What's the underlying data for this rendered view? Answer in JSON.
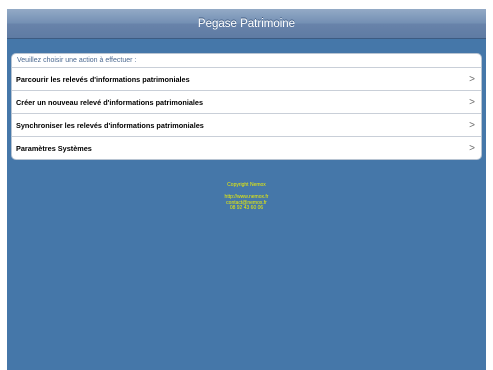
{
  "header": {
    "title": "Pegase Patrimoine"
  },
  "menu": {
    "prompt": "Veuillez choisir une action à effectuer :",
    "items": [
      {
        "label": "Parcourir les relevés d'informations patrimoniales"
      },
      {
        "label": "Créer un nouveau relevé d'informations patrimoniales"
      },
      {
        "label": "Synchroniser les relevés d'informations patrimoniales"
      },
      {
        "label": "Paramètres Systèmes"
      }
    ],
    "chevron_glyph": ">"
  },
  "footer": {
    "copyright": "Copyright Nemox",
    "website": "http://www.nemox.fr",
    "email": "contact@nemox.fr",
    "phone": "08 92 43 60 06"
  },
  "colors": {
    "background": "#4577a9",
    "titlebar": "#6f8db3",
    "footer_text": "#f0f000"
  }
}
